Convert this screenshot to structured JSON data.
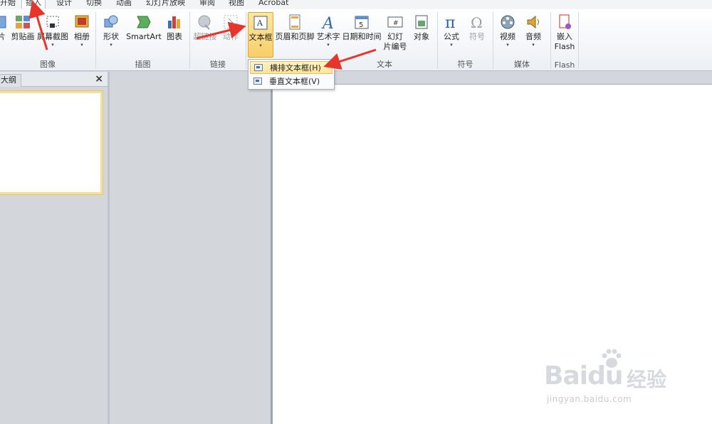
{
  "tabs": [
    "开始",
    "插入",
    "设计",
    "切换",
    "动画",
    "幻灯片放映",
    "审阅",
    "视图",
    "Acrobat"
  ],
  "active_tab": "插入",
  "groups": {
    "image": {
      "label": "图像",
      "buttons": [
        "片",
        "剪贴画",
        "屏幕截图",
        "相册"
      ]
    },
    "illustration": {
      "label": "插图",
      "buttons": [
        "形状",
        "SmartArt",
        "图表"
      ]
    },
    "link": {
      "label": "链接",
      "buttons": [
        "超链接",
        "动作"
      ]
    },
    "text": {
      "label": "文本",
      "buttons": [
        "文本框",
        "页眉和页脚",
        "艺术字",
        "日期和时间",
        "幻灯",
        "片编号",
        "对象"
      ]
    },
    "symbol": {
      "label": "符号",
      "buttons": [
        "公式",
        "符号"
      ]
    },
    "media": {
      "label": "媒体",
      "buttons": [
        "视频",
        "音频"
      ]
    },
    "flash": {
      "label": "Flash",
      "buttons": [
        "嵌入",
        "Flash"
      ]
    }
  },
  "dropdown": {
    "items": [
      "横排文本框(H)",
      "垂直文本框(V)"
    ],
    "highlighted": "横排文本框(H)"
  },
  "left_pane": {
    "tab": "大纲",
    "close": "×"
  },
  "watermark": {
    "main": "Baidu",
    "cn": "经验",
    "sub": "jingyan.baidu.com"
  },
  "colors": {
    "accent_arrow": "#e8352b",
    "pressed": "#f7cf68",
    "highlight": "#fde495"
  }
}
